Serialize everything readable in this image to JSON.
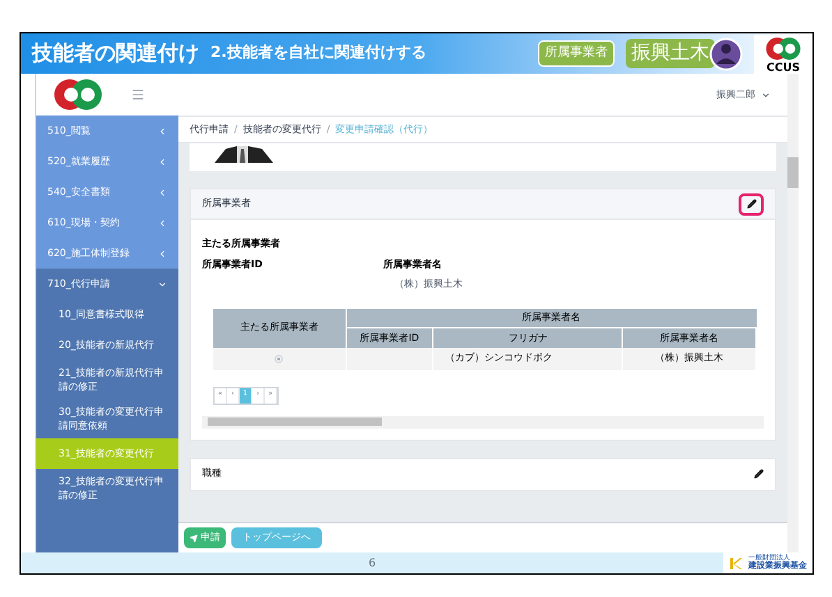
{
  "slide": {
    "title": "技能者の関連付け",
    "subtitle": "2.技能者を自社に関連付けする",
    "role_badge": "所属事業者",
    "company": "振興土木",
    "logo_text": "CCUS",
    "page_number": "6",
    "footer_logo": "建設業振興基金",
    "footer_logo_small": "一般財団法人"
  },
  "app": {
    "user_menu": "振興二郎",
    "sidebar": [
      {
        "label": "510_閲覧",
        "selected": false,
        "expanded": false
      },
      {
        "label": "520_就業履歴",
        "selected": false,
        "expanded": false
      },
      {
        "label": "540_安全書類",
        "selected": false,
        "expanded": false
      },
      {
        "label": "610_現場・契約",
        "selected": false,
        "expanded": false
      },
      {
        "label": "620_施工体制登録",
        "selected": false,
        "expanded": false
      },
      {
        "label": "710_代行申請",
        "selected": false,
        "expanded": true,
        "children": [
          {
            "label": "10_同意書様式取得",
            "selected": false
          },
          {
            "label": "20_技能者の新規代行",
            "selected": false
          },
          {
            "label": "21_技能者の新規代行申請の修正",
            "selected": false
          },
          {
            "label": "30_技能者の変更代行申請同意依頼",
            "selected": false
          },
          {
            "label": "31_技能者の変更代行",
            "selected": true
          },
          {
            "label": "32_技能者の変更代行申請の修正",
            "selected": false
          }
        ]
      }
    ],
    "breadcrumb_separators": [
      "/",
      "/"
    ],
    "breadcrumb": [
      {
        "label": "代行申請",
        "current": false
      },
      {
        "label": "技能者の変更代行",
        "current": false
      },
      {
        "label": "変更申請確認（代行）",
        "current": true
      }
    ],
    "employer_panel": {
      "title": "所属事業者",
      "highlighted": true,
      "main_label": "主たる所属事業者",
      "id_label": "所属事業者ID",
      "name_label": "所属事業者名",
      "name_value": "（株）振興土木",
      "table": {
        "group_header": "所属事業者名",
        "col_main": "主たる所属事業者",
        "columns": [
          "所属事業者ID",
          "フリガナ",
          "所属事業者名"
        ],
        "rows": [
          {
            "selected": true,
            "cells": [
              "",
              "（カブ）シンコウドボク",
              "（株）振興土木"
            ]
          }
        ]
      },
      "pager": [
        {
          "label": "«",
          "selected": false
        },
        {
          "label": "‹",
          "selected": false
        },
        {
          "label": "1",
          "selected": true
        },
        {
          "label": "›",
          "selected": false
        },
        {
          "label": "»",
          "selected": false
        }
      ]
    },
    "job_panel": {
      "title": "職種"
    },
    "buttons": [
      {
        "label": "申請",
        "kind": "submit"
      },
      {
        "label": "トップページへ",
        "kind": "link"
      }
    ]
  }
}
